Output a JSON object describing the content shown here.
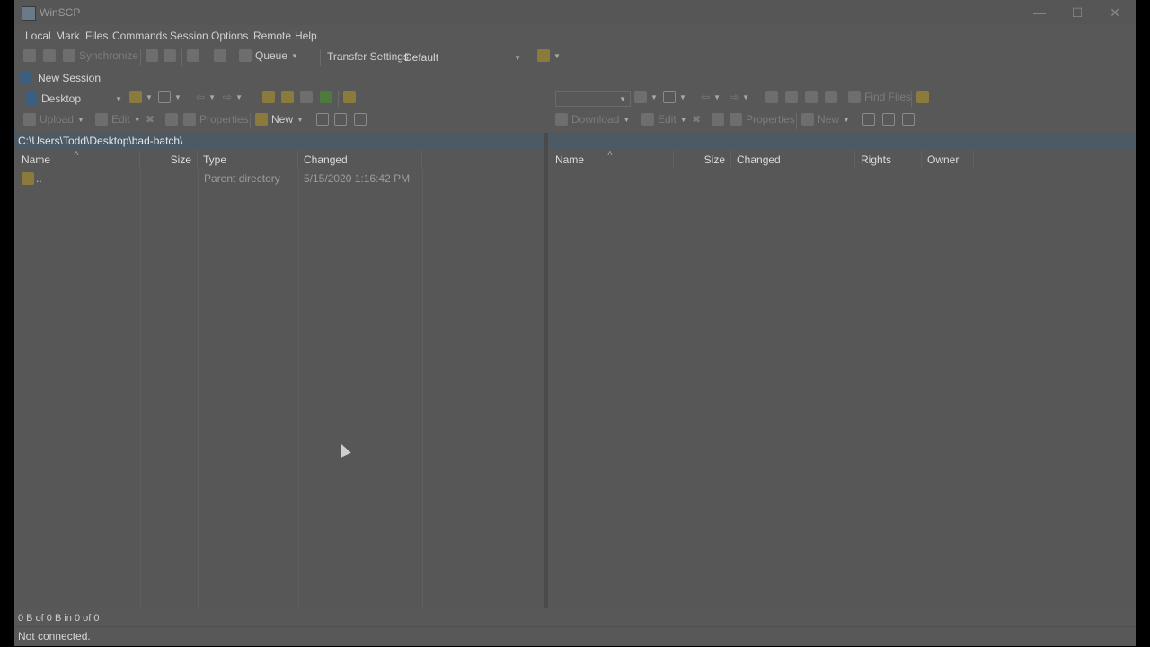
{
  "window": {
    "title": "WinSCP",
    "minimize": "—",
    "maximize": "☐",
    "close": "✕"
  },
  "menu": [
    "Local",
    "Mark",
    "Files",
    "Commands",
    "Session",
    "Options",
    "Remote",
    "Help"
  ],
  "toolbar": {
    "synchronize": "Synchronize",
    "queue": "Queue",
    "transfer_settings_label": "Transfer Settings",
    "transfer_settings_value": "Default"
  },
  "session": {
    "new_session": "New Session"
  },
  "left": {
    "drive": "Desktop",
    "upload": "Upload",
    "edit": "Edit",
    "properties": "Properties",
    "new": "New",
    "path": "C:\\Users\\Todd\\Desktop\\bad-batch\\",
    "columns": [
      "Name",
      "Size",
      "Type",
      "Changed"
    ],
    "rows": [
      {
        "name": "..",
        "size": "",
        "type": "Parent directory",
        "changed": "5/15/2020  1:16:42 PM"
      }
    ]
  },
  "right": {
    "find_files": "Find Files",
    "download": "Download",
    "edit": "Edit",
    "properties": "Properties",
    "new": "New",
    "columns": [
      "Name",
      "Size",
      "Changed",
      "Rights",
      "Owner"
    ]
  },
  "status": {
    "selection": "0 B of 0 B in 0 of 0",
    "connection": "Not connected."
  }
}
